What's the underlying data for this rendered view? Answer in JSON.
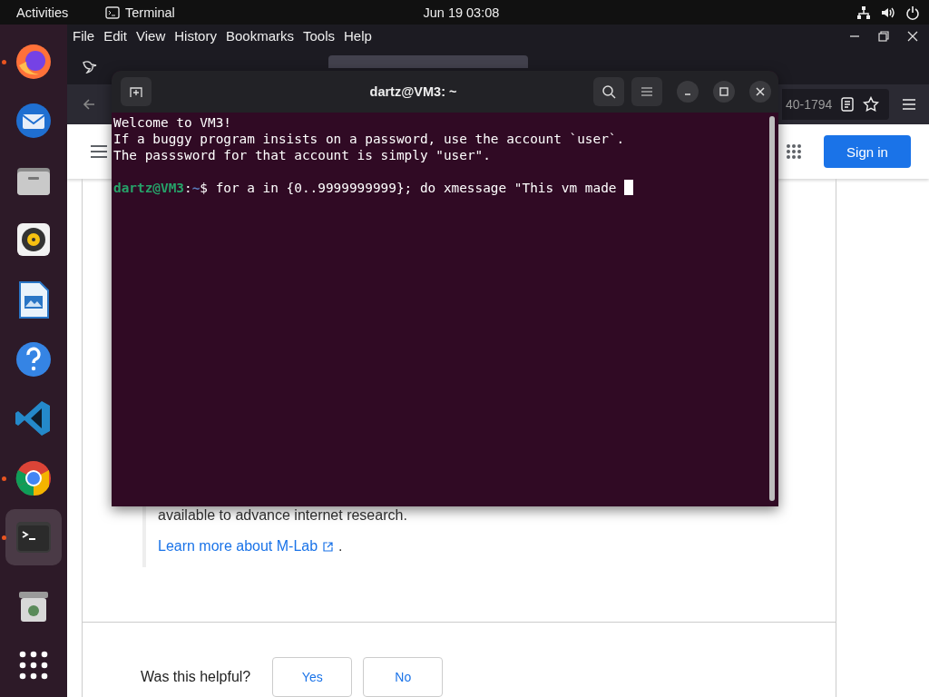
{
  "top_bar": {
    "activities": "Activities",
    "app": "Terminal",
    "clock": "Jun 19  03:08"
  },
  "dock": {
    "items": [
      {
        "kind": "firefox",
        "running": true,
        "selected": false
      },
      {
        "kind": "mail",
        "running": false,
        "selected": false
      },
      {
        "kind": "files",
        "running": false,
        "selected": false
      },
      {
        "kind": "speaker",
        "running": false,
        "selected": false
      },
      {
        "kind": "writer",
        "running": false,
        "selected": false
      },
      {
        "kind": "help",
        "running": false,
        "selected": false
      },
      {
        "kind": "code",
        "running": false,
        "selected": false
      },
      {
        "kind": "chrome",
        "running": true,
        "selected": false
      },
      {
        "kind": "terminal",
        "running": true,
        "selected": true
      },
      {
        "kind": "trash",
        "running": false,
        "selected": false
      },
      {
        "kind": "apps",
        "running": false,
        "selected": false
      }
    ]
  },
  "browser": {
    "menu": [
      "File",
      "Edit",
      "View",
      "History",
      "Bookmarks",
      "Tools",
      "Help"
    ],
    "url_fragment": "40-1794",
    "page": {
      "sign_in": "Sign in",
      "text_line": "available to advance internet research.",
      "link": "Learn more about M-Lab",
      "link_suffix": ".",
      "feedback": {
        "question": "Was this helpful?",
        "buttons": [
          "Yes",
          "No"
        ]
      }
    }
  },
  "terminal": {
    "title": "dartz@VM3: ~",
    "lines": [
      "Welcome to VM3!",
      "If a buggy program insists on a password, use the account `user`.",
      "The passsword for that account is simply \"user\"."
    ],
    "prompt": {
      "user_host": "dartz@VM3",
      "separator": ":",
      "path": "~",
      "symbol": "$",
      "command": "for a in {0..9999999999}; do xmessage \"This vm made "
    }
  }
}
